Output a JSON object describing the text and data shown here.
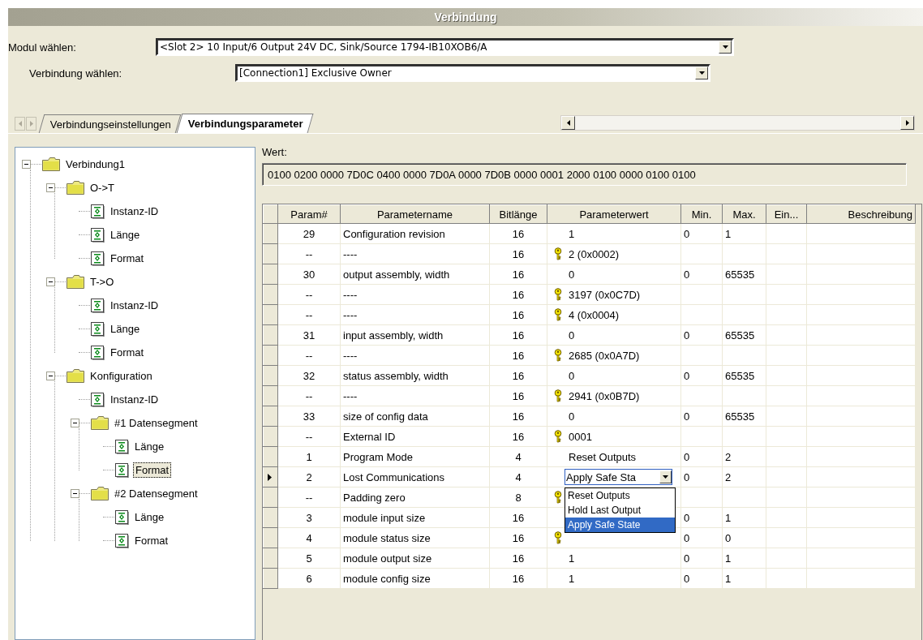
{
  "window": {
    "title": "Verbindung"
  },
  "module_select": {
    "label": "Modul wählen:",
    "value": "<Slot 2> 10 Input/6 Output 24V DC, Sink/Source 1794-IB10XOB6/A"
  },
  "connection_select": {
    "label": "Verbindung wählen:",
    "value": "[Connection1] Exclusive Owner"
  },
  "tabs": [
    {
      "label": "Verbindungseinstellungen",
      "selected": false
    },
    {
      "label": "Verbindungsparameter",
      "selected": true
    }
  ],
  "tree": [
    {
      "label": "Verbindung1",
      "kind": "folder",
      "expanded": true,
      "selected": false,
      "children": [
        {
          "label": "O->T",
          "kind": "folder",
          "expanded": true,
          "selected": false,
          "children": [
            {
              "label": "Instanz-ID",
              "kind": "item",
              "selected": false
            },
            {
              "label": "Länge",
              "kind": "item",
              "selected": false
            },
            {
              "label": "Format",
              "kind": "item",
              "selected": false
            }
          ]
        },
        {
          "label": "T->O",
          "kind": "folder",
          "expanded": true,
          "selected": false,
          "children": [
            {
              "label": "Instanz-ID",
              "kind": "item",
              "selected": false
            },
            {
              "label": "Länge",
              "kind": "item",
              "selected": false
            },
            {
              "label": "Format",
              "kind": "item",
              "selected": false
            }
          ]
        },
        {
          "label": "Konfiguration",
          "kind": "folder",
          "expanded": true,
          "selected": false,
          "children": [
            {
              "label": "Instanz-ID",
              "kind": "item",
              "selected": false
            },
            {
              "label": "#1 Datensegment",
              "kind": "folder",
              "expanded": true,
              "selected": false,
              "children": [
                {
                  "label": "Länge",
                  "kind": "item",
                  "selected": false
                },
                {
                  "label": "Format",
                  "kind": "item",
                  "selected": true
                }
              ]
            },
            {
              "label": "#2 Datensegment",
              "kind": "folder",
              "expanded": true,
              "selected": false,
              "children": [
                {
                  "label": "Länge",
                  "kind": "item",
                  "selected": false
                },
                {
                  "label": "Format",
                  "kind": "item",
                  "selected": false
                }
              ]
            }
          ]
        }
      ]
    }
  ],
  "value_display": {
    "label": "Wert:",
    "value": "0100 0200 0000 7D0C 0400 0000 7D0A 0000 7D0B 0000 0001 2000 0100 0000 0100 0100"
  },
  "table": {
    "columns": [
      "Param#",
      "Parametername",
      "Bitlänge",
      "Parameterwert",
      "Min.",
      "Max.",
      "Ein...",
      "Beschreibung"
    ],
    "rows": [
      {
        "param": "29",
        "name": "Configuration revision",
        "bits": "16",
        "key": false,
        "value": "1",
        "min": "0",
        "max": "1",
        "current": false
      },
      {
        "param": "--",
        "name": "----",
        "bits": "16",
        "key": true,
        "value": "2  (0x0002)",
        "current": false
      },
      {
        "param": "30",
        "name": "output assembly, width",
        "bits": "16",
        "key": false,
        "value": "0",
        "min": "0",
        "max": "65535",
        "current": false
      },
      {
        "param": "--",
        "name": "----",
        "bits": "16",
        "key": true,
        "value": "3197  (0x0C7D)",
        "current": false
      },
      {
        "param": "--",
        "name": "----",
        "bits": "16",
        "key": true,
        "value": "4  (0x0004)",
        "current": false
      },
      {
        "param": "31",
        "name": "input assembly, width",
        "bits": "16",
        "key": false,
        "value": "0",
        "min": "0",
        "max": "65535",
        "current": false
      },
      {
        "param": "--",
        "name": "----",
        "bits": "16",
        "key": true,
        "value": "2685  (0x0A7D)",
        "current": false
      },
      {
        "param": "32",
        "name": "status assembly, width",
        "bits": "16",
        "key": false,
        "value": "0",
        "min": "0",
        "max": "65535",
        "current": false
      },
      {
        "param": "--",
        "name": "----",
        "bits": "16",
        "key": true,
        "value": "2941  (0x0B7D)",
        "current": false
      },
      {
        "param": "33",
        "name": "size of config data",
        "bits": "16",
        "key": false,
        "value": "0",
        "min": "0",
        "max": "65535",
        "current": false
      },
      {
        "param": "--",
        "name": "External ID",
        "bits": "16",
        "key": true,
        "value": "0001",
        "current": false
      },
      {
        "param": "1",
        "name": "Program Mode",
        "bits": "4",
        "key": false,
        "value": "Reset Outputs",
        "min": "0",
        "max": "2",
        "current": false
      },
      {
        "param": "2",
        "name": "Lost Communications",
        "bits": "4",
        "key": false,
        "kind": "dropdown",
        "editor": {
          "value": "Apply Safe Sta",
          "options": [
            {
              "label": "Reset Outputs",
              "selected": false
            },
            {
              "label": "Hold Last Output",
              "selected": false
            },
            {
              "label": "Apply Safe State",
              "selected": true
            }
          ]
        },
        "min": "0",
        "max": "2",
        "current": true
      },
      {
        "param": "--",
        "name": "Padding zero",
        "bits": "8",
        "key": true,
        "current": false
      },
      {
        "param": "3",
        "name": "module input size",
        "bits": "16",
        "key": false,
        "min": "0",
        "max": "1",
        "current": false
      },
      {
        "param": "4",
        "name": "module status size",
        "bits": "16",
        "key": true,
        "min": "0",
        "max": "0",
        "current": false
      },
      {
        "param": "5",
        "name": "module output size",
        "bits": "16",
        "key": false,
        "value": "1",
        "min": "0",
        "max": "1",
        "current": false
      },
      {
        "param": "6",
        "name": "module config size",
        "bits": "16",
        "key": false,
        "value": "1",
        "min": "0",
        "max": "1",
        "current": false
      }
    ]
  }
}
